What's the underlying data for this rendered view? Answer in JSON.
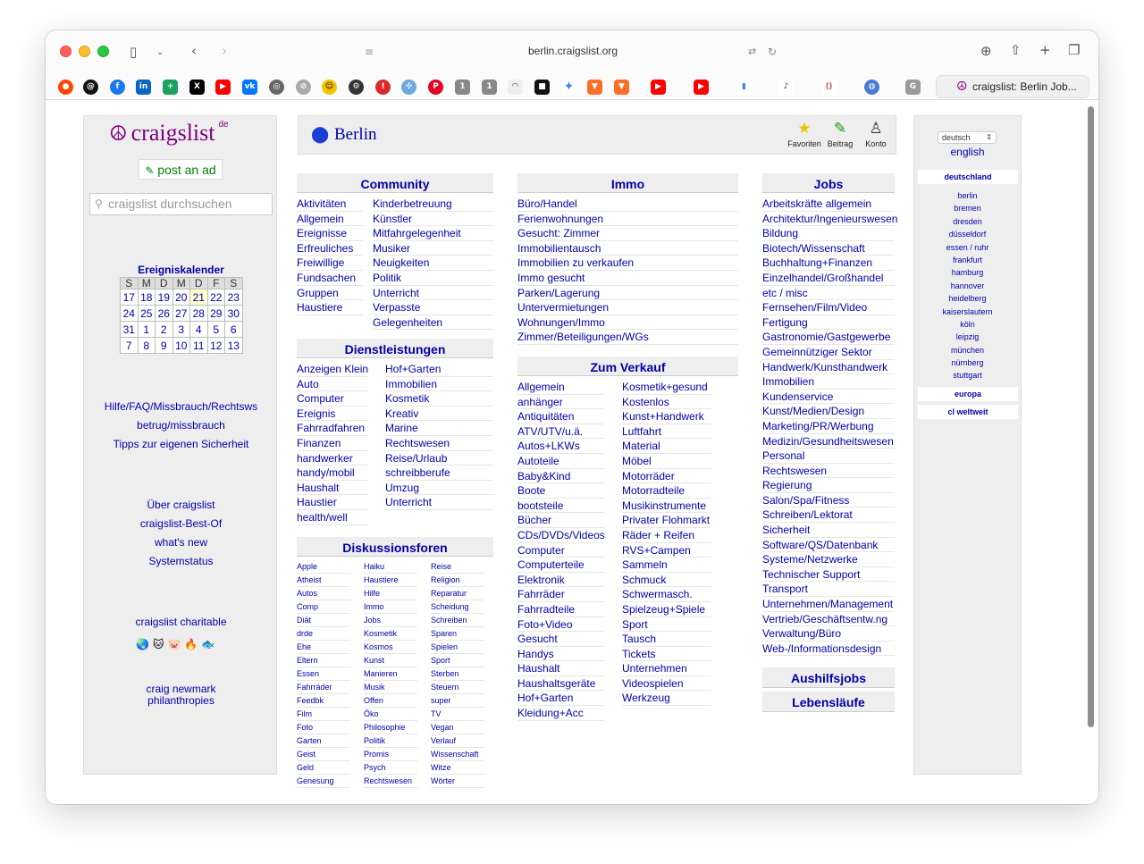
{
  "browser": {
    "url": "berlin.craigslist.org",
    "tab_title": "craigslist: Berlin Job..."
  },
  "logo": {
    "text": "craigslist",
    "superscript": "de"
  },
  "left": {
    "post_ad": "post an ad",
    "search_placeholder": "craigslist durchsuchen",
    "calendar_title": "Ereigniskalender",
    "calendar_days": [
      "S",
      "M",
      "D",
      "M",
      "D",
      "F",
      "S"
    ],
    "calendar_weeks": [
      [
        "17",
        "18",
        "19",
        "20",
        "21",
        "22",
        "23"
      ],
      [
        "24",
        "25",
        "26",
        "27",
        "28",
        "29",
        "30"
      ],
      [
        "31",
        "1",
        "2",
        "3",
        "4",
        "5",
        "6"
      ],
      [
        "7",
        "8",
        "9",
        "10",
        "11",
        "12",
        "13"
      ]
    ],
    "help_links": [
      "Hilfe/FAQ/Missbrauch/Rechtsws",
      "betrug/missbrauch",
      "Tipps zur eigenen Sicherheit"
    ],
    "about_links": [
      "Über craigslist",
      "craigslist-Best-Of",
      "what's new",
      "Systemstatus"
    ],
    "charitable": "craigslist charitable",
    "newmark_line1": "craig newmark",
    "newmark_line2": "philanthropies"
  },
  "topbar": {
    "city": "Berlin",
    "favorites": "Favoriten",
    "post": "Beitrag",
    "account": "Konto"
  },
  "community": {
    "title": "Community",
    "col1": [
      "Aktivitäten",
      "Allgemein",
      "Ereignisse",
      "Erfreuliches",
      "Freiwillige",
      "Fundsachen",
      "Gruppen",
      "Haustiere"
    ],
    "col2": [
      "Kinderbetreuung",
      "Künstler",
      "Mitfahrgelegenheit",
      "Musiker",
      "Neuigkeiten",
      "Politik",
      "Unterricht",
      "Verpasste",
      "Gelegenheiten"
    ]
  },
  "services": {
    "title": "Dienstleistungen",
    "col1": [
      "Anzeigen Klein",
      "Auto",
      "Computer",
      "Ereignis",
      "Fahrradfahren",
      "Finanzen",
      "handwerker",
      "handy/mobil",
      "Haushalt",
      "Haustier",
      "health/well"
    ],
    "col2": [
      "Hof+Garten",
      "Immobilien",
      "Kosmetik",
      "Kreativ",
      "Marine",
      "Rechtswesen",
      "Reise/Urlaub",
      "schreibberufe",
      "Umzug",
      "Unterricht"
    ]
  },
  "forums": {
    "title": "Diskussionsforen",
    "col1": [
      "Apple",
      "Atheist",
      "Autos",
      "Comp",
      "Diät",
      "drde",
      "Ehe",
      "Eltern",
      "Essen",
      "Fahrräder",
      "Feedbk",
      "Film",
      "Foto",
      "Garten",
      "Geist",
      "Geld",
      "Genesung"
    ],
    "col2": [
      "Haiku",
      "Haustiere",
      "Hilfe",
      "Immo",
      "Jobs",
      "Kosmetik",
      "Kosmos",
      "Kunst",
      "Manieren",
      "Musik",
      "Offen",
      "Öko",
      "Philosophie",
      "Politik",
      "Promis",
      "Psych",
      "Rechtswesen"
    ],
    "col3": [
      "Reise",
      "Religion",
      "Reparatur",
      "Scheidung",
      "Schreiben",
      "Sparen",
      "Spielen",
      "Sport",
      "Sterben",
      "Steuern",
      "super",
      "TV",
      "Vegan",
      "Verlauf",
      "Wissenschaft",
      "Witze",
      "Wörter"
    ]
  },
  "immo": {
    "title": "Immo",
    "items": [
      "Büro/Handel",
      "Ferienwohnungen",
      "Gesucht: Zimmer",
      "Immobilientausch",
      "Immobilien zu verkaufen",
      "Immo gesucht",
      "Parken/Lagerung",
      "Untervermietungen",
      "Wohnungen/Immo",
      "Zimmer/Beteiligungen/WGs"
    ]
  },
  "sale": {
    "title": "Zum Verkauf",
    "col1": [
      "Allgemein",
      "anhänger",
      "Antiquitäten",
      "ATV/UTV/u.ä.",
      "Autos+LKWs",
      "Autoteile",
      "Baby&Kind",
      "Boote",
      "bootsteile",
      "Bücher",
      "CDs/DVDs/Videos",
      "Computer",
      "Computerteile",
      "Elektronik",
      "Fahrräder",
      "Fahrradteile",
      "Foto+Video",
      "Gesucht",
      "Handys",
      "Haushalt",
      "Haushaltsgeräte",
      "Hof+Garten",
      "Kleidung+Acc"
    ],
    "col2": [
      "Kosmetik+gesund",
      "Kostenlos",
      "Kunst+Handwerk",
      "Luftfahrt",
      "Material",
      "Möbel",
      "Motorräder",
      "Motorradteile",
      "Musikinstrumente",
      "Privater Flohmarkt",
      "Räder + Reifen",
      "RVS+Campen",
      "Sammeln",
      "Schmuck",
      "Schwermasch.",
      "Spielzeug+Spiele",
      "Sport",
      "Tausch",
      "Tickets",
      "Unternehmen",
      "Videospielen",
      "Werkzeug"
    ]
  },
  "jobs": {
    "title": "Jobs",
    "items": [
      "Arbeitskräfte allgemein",
      "Architektur/Ingenieurswesen",
      "Bildung",
      "Biotech/Wissenschaft",
      "Buchhaltung+Finanzen",
      "Einzelhandel/Großhandel",
      "etc / misc",
      "Fernsehen/Film/Video",
      "Fertigung",
      "Gastronomie/Gastgewerbe",
      "Gemeinnütziger Sektor",
      "Handwerk/Kunsthandwerk",
      "Immobilien",
      "Kundenservice",
      "Kunst/Medien/Design",
      "Marketing/PR/Werbung",
      "Medizin/Gesundheitswesen",
      "Personal",
      "Rechtswesen",
      "Regierung",
      "Salon/Spa/Fitness",
      "Schreiben/Lektorat",
      "Sicherheit",
      "Software/QS/Datenbank",
      "Systeme/Netzwerke",
      "Technischer Support",
      "Transport",
      "Unternehmen/Management",
      "Vertrieb/Geschäftsentw.ng",
      "Verwaltung/Büro",
      "Web-/Informationsdesign"
    ],
    "gigs": "Aushilfsjobs",
    "resumes": "Lebensläufe"
  },
  "right": {
    "language_selected": "deutsch",
    "english": "english",
    "germany": "deutschland",
    "cities": [
      "berlin",
      "bremen",
      "dresden",
      "düsseldorf",
      "essen / ruhr",
      "frankfurt",
      "hamburg",
      "hannover",
      "heidelberg",
      "kaiserslautern",
      "köln",
      "leipzig",
      "münchen",
      "nürnberg",
      "stuttgart"
    ],
    "europe": "europa",
    "worldwide": "cl weltweit"
  }
}
